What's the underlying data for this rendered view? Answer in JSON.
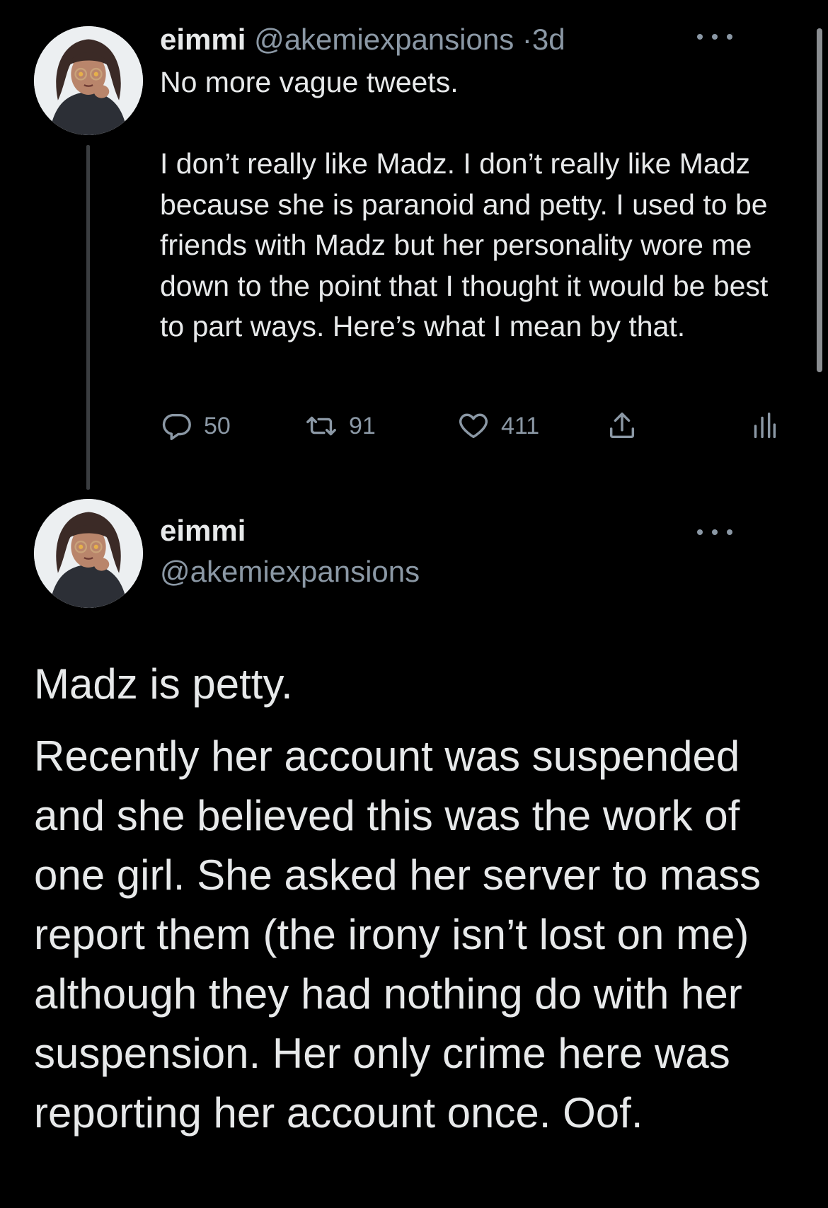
{
  "colors": {
    "background": "#000000",
    "primary_text": "#e7e9ea",
    "secondary_text": "#8b98a5",
    "thread_line": "#3a3d40"
  },
  "tweet1": {
    "avatar_icon": "avatar-anime-girl-glasses",
    "name": "eimmi",
    "handle": "@akemiexpansions",
    "separator": "·",
    "time": "3d",
    "text": "No more vague tweets.\n\nI don’t really like Madz. I don’t really like Madz because she is paranoid and petty. I used to be friends with Madz but her personality wore me down to the point that I thought it would be best to part ways. Here’s what I mean by that.",
    "actions": {
      "reply_icon": "reply-icon",
      "reply_count": "50",
      "retweet_icon": "retweet-icon",
      "retweet_count": "91",
      "like_icon": "heart-icon",
      "like_count": "411",
      "share_icon": "share-icon",
      "analytics_icon": "analytics-icon"
    }
  },
  "tweet2": {
    "avatar_icon": "avatar-anime-girl-glasses",
    "name": "eimmi",
    "handle": "@akemiexpansions",
    "paragraphs": [
      "Madz is petty.",
      "Recently her account was suspended and she believed this was the work of one girl. She asked her server to mass report them (the irony isn’t lost on me) although they had nothing do with her suspension. Her only crime here was reporting her account once. Oof."
    ]
  }
}
